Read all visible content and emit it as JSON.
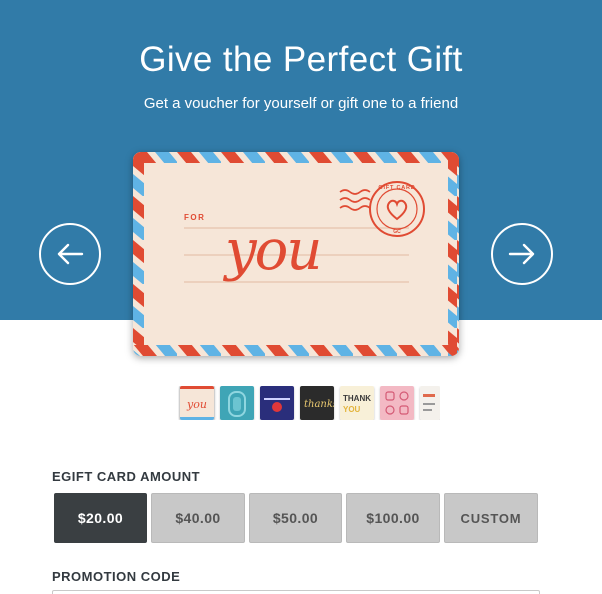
{
  "hero": {
    "title": "Give the Perfect Gift",
    "subtitle": "Get a voucher for yourself or gift one to a friend",
    "background_color": "#317ba8"
  },
  "carousel": {
    "prev_icon": "arrow-left-icon",
    "next_icon": "arrow-right-icon",
    "card": {
      "label_for": "FOR",
      "script_text": "you",
      "stamp_text": "GIFT CARD",
      "stamp_sub": "GC",
      "accent_red": "#e04b33",
      "accent_blue": "#5fb3e5",
      "paper_color": "#f6e6d8"
    },
    "thumbnails": [
      {
        "design": "airmail-you",
        "selected": true
      },
      {
        "design": "teal-pattern",
        "selected": false
      },
      {
        "design": "navy-balloon",
        "selected": false
      },
      {
        "design": "black-thanks",
        "selected": false
      },
      {
        "design": "thank-you-cream",
        "selected": false
      },
      {
        "design": "pink-icons",
        "selected": false
      },
      {
        "design": "partial-white",
        "selected": false
      }
    ]
  },
  "amount": {
    "label": "EGIFT CARD AMOUNT",
    "options": [
      "$20.00",
      "$40.00",
      "$50.00",
      "$100.00",
      "CUSTOM"
    ],
    "selected": "$20.00"
  },
  "promo": {
    "label": "PROMOTION CODE",
    "value": ""
  }
}
